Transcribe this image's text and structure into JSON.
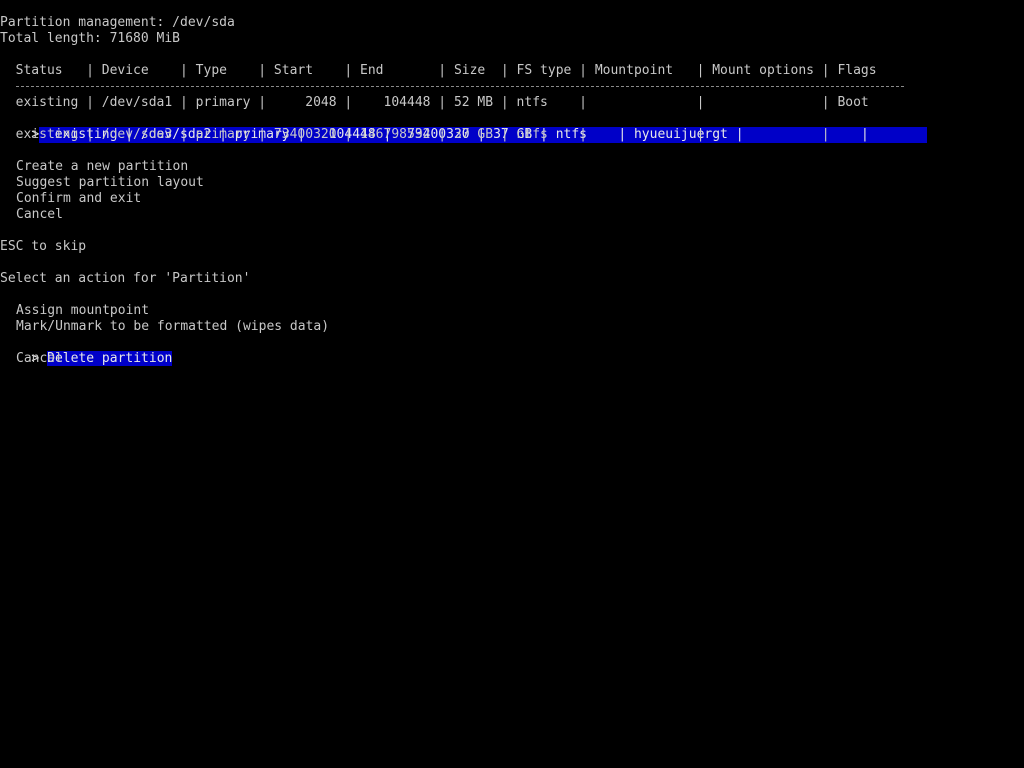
{
  "header": {
    "title": "Partition management: /dev/sda",
    "total_length": "Total length: 71680 MiB"
  },
  "table": {
    "columns": [
      "Status",
      "Device",
      "Type",
      "Start",
      "End",
      "Size",
      "FS type",
      "Mountpoint",
      "Mount options",
      "Flags"
    ],
    "header_line": "  Status   | Device    | Type    | Start    | End       | Size  | FS type | Mountpoint   | Mount options | Flags",
    "rows": [
      {
        "status": "existing",
        "device": "/dev/sda1",
        "type": "primary",
        "start": "2048",
        "end": "104448",
        "size": "52 MB",
        "fs_type": "ntfs",
        "mountpoint": "",
        "mount_options": "",
        "flags": "Boot",
        "line": "  existing | /dev/sda1 | primary |     2048 |    104448 | 52 MB | ntfs    |              |               | Boot"
      },
      {
        "status": "existing",
        "device": "/dev/sda2",
        "type": "primary",
        "start": "104448",
        "end": "73400320",
        "size": "37 GB",
        "fs_type": "ntfs",
        "mountpoint": "hyueuijuergt",
        "mount_options": "",
        "flags": "",
        "selected": true,
        "line": "  existing | /dev/sda2 | primary |   104448 |  73400320 | 37 GB | ntfs    | hyueuijuergt |               |     "
      },
      {
        "status": "existing",
        "device": "/dev/sda3",
        "type": "primary",
        "start": "73400320",
        "end": "146798592",
        "size": "37 GB",
        "fs_type": "ntfs",
        "mountpoint": "",
        "mount_options": "",
        "flags": "",
        "line": "  existing | /dev/sda3 | primary | 73400320 | 146798592 | 37 GB | ntfs    |              |               |"
      }
    ]
  },
  "main_menu": {
    "items": [
      "Create a new partition",
      "Suggest partition layout",
      "Confirm and exit",
      "Cancel"
    ]
  },
  "hint": "ESC to skip",
  "prompt": "Select an action for 'Partition'",
  "action_menu": {
    "items": [
      "Assign mountpoint",
      "Mark/Unmark to be formatted (wipes data)",
      "Delete partition",
      "Cancel"
    ],
    "selected_index": 2
  },
  "cursor_glyph": ">",
  "colors": {
    "background": "#000000",
    "text": "#c8c8c8",
    "selection": "#0000c8"
  }
}
